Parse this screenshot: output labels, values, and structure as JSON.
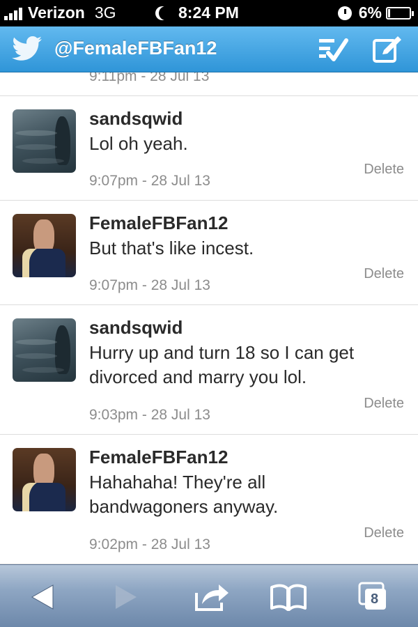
{
  "status_bar": {
    "carrier": "Verizon",
    "network": "3G",
    "time": "8:24 PM",
    "battery": "6%"
  },
  "header": {
    "handle": "@FemaleFBFan12",
    "icons": [
      "twitter-bird-icon",
      "checklist-icon",
      "compose-icon"
    ]
  },
  "messages": {
    "partial_timestamp": "9:11pm - 28 Jul 13",
    "items": [
      {
        "name": "sandsqwid",
        "text": "Lol oh yeah.",
        "time": "9:07pm - 28 Jul 13",
        "action": "Delete"
      },
      {
        "name": "FemaleFBFan12",
        "text": "But that's like incest.",
        "time": "9:07pm - 28 Jul 13",
        "action": "Delete"
      },
      {
        "name": "sandsqwid",
        "text": "Hurry up and turn 18 so I can get divorced and marry you lol.",
        "time": "9:03pm - 28 Jul 13",
        "action": "Delete"
      },
      {
        "name": "FemaleFBFan12",
        "text": "Hahahaha! They're all bandwagoners anyway.",
        "time": "9:02pm - 28 Jul 13",
        "action": "Delete"
      }
    ]
  },
  "toolbar": {
    "tab_count": "8",
    "icons": [
      "back-arrow-icon",
      "forward-arrow-icon",
      "share-icon",
      "bookmarks-icon",
      "tabs-icon"
    ]
  },
  "colors": {
    "header_blue": "#2f95d8",
    "toolbar_blue": "#8ea6c3",
    "meta_gray": "#8c8c8c"
  }
}
